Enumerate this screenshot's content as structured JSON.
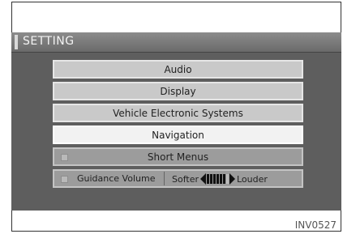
{
  "header": {
    "title": "SETTING"
  },
  "menu": {
    "audio": "Audio",
    "display": "Display",
    "vehicle": "Vehicle Electronic Systems",
    "navigation": "Navigation",
    "short_menus": "Short Menus",
    "guidance_volume": {
      "label": "Guidance Volume",
      "softer": "Softer",
      "louder": "Louder",
      "level_segments_on": 6,
      "segments_total": 7
    }
  },
  "caption": "INV0527"
}
